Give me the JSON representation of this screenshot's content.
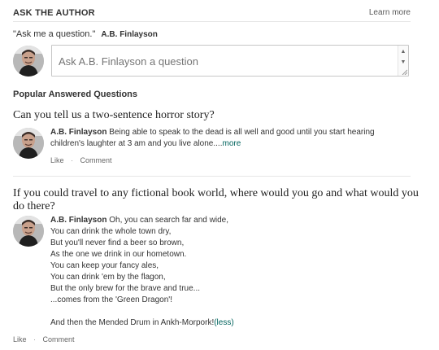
{
  "header": {
    "title": "ASK THE AUTHOR",
    "learn_more": "Learn more"
  },
  "quote": {
    "text": "\"Ask me a question.\"",
    "author": "A.B. Finlayson"
  },
  "ask_box": {
    "placeholder": "Ask A.B. Finlayson a question"
  },
  "popular": {
    "heading": "Popular Answered Questions"
  },
  "questions": [
    {
      "title": "Can you tell us a two-sentence horror story?",
      "author": "A.B. Finlayson",
      "answer_text": "Being able to speak to the dead is all well and good until you start hearing children's laughter at 3 am and you live alone....",
      "more_label": "more",
      "like_label": "Like",
      "comment_label": "Comment"
    },
    {
      "title": "If you could travel to any fictional book world, where would you go and what would you do there?",
      "author": "A.B. Finlayson",
      "answer_lines": [
        "Oh, you can search far and wide,",
        "You can drink the whole town dry,",
        "But you'll never find a beer so brown,",
        "As the one we drink in our hometown.",
        "You can keep your fancy ales,",
        "You can drink 'em by the flagon,",
        "But the only brew for the brave and true...",
        "...comes from the 'Green Dragon'!",
        "",
        "And then the Mended Drum in Ankh-Morpork!"
      ],
      "less_label": "(less)",
      "like_label": "Like",
      "comment_label": "Comment"
    }
  ],
  "icons": {
    "avatar": "author-avatar-icon",
    "scroll_up": "scroll-up-icon",
    "scroll_down": "scroll-down-icon",
    "resize_grip": "resize-grip-icon"
  },
  "colors": {
    "link": "#00635d",
    "text": "#333333",
    "muted": "#666666",
    "border": "#c7c7c7"
  }
}
